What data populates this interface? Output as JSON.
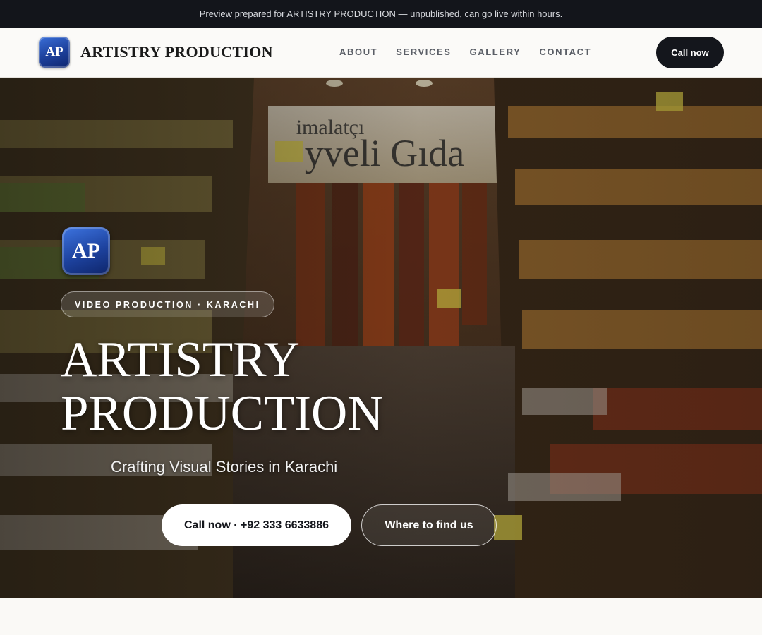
{
  "banner": {
    "text": "Preview prepared for ARTISTRY PRODUCTION — unpublished, can go live within hours."
  },
  "header": {
    "logo_text": "AP",
    "brand_name": "ARTISTRY PRODUCTION",
    "nav": [
      "ABOUT",
      "SERVICES",
      "GALLERY",
      "CONTACT"
    ],
    "call_label": "Call now"
  },
  "hero": {
    "logo_text": "AP",
    "tagline_pill": "VIDEO PRODUCTION · KARACHI",
    "title_line1": "ARTISTRY",
    "title_line2": "PRODUCTION",
    "subtitle": "Crafting Visual Stories in Karachi",
    "primary_button": "Call now · +92 333 6633886",
    "secondary_button": "Where to find us",
    "background_sign_text": "imalatçı  yveli Gıda"
  },
  "colors": {
    "topbar_bg": "#13151b",
    "nav_bg": "#fbfaf8",
    "accent_dark": "#14161c",
    "logo_blue": "#1d429e",
    "page_bg": "#faf9f6"
  },
  "icons": {
    "logo": "ap-monogram-badge"
  }
}
